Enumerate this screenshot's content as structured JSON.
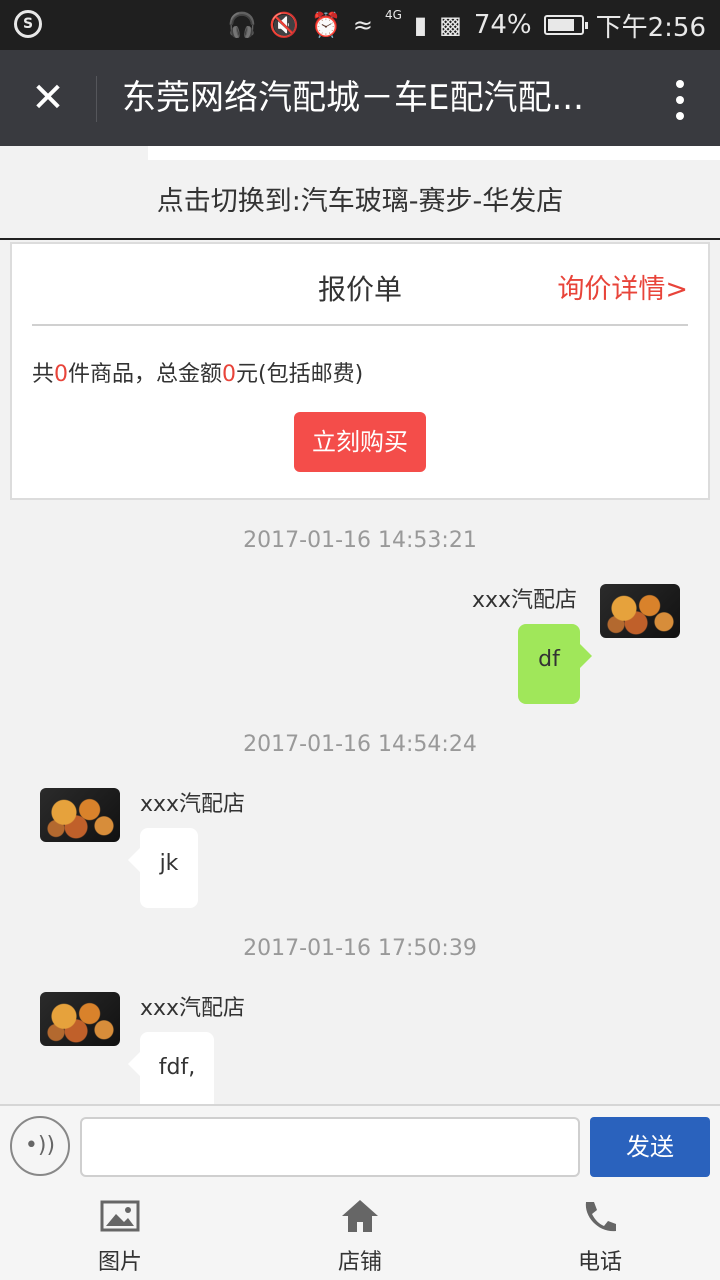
{
  "status_bar": {
    "battery": "74%",
    "time": "下午2:56",
    "network": "4G"
  },
  "title_bar": {
    "title": "东莞网络汽配城－车E配汽配..."
  },
  "switch_store": {
    "text": "点击切换到:汽车玻璃-赛步-华发店"
  },
  "quote_card": {
    "title": "报价单",
    "details_link": "询价详情>",
    "summary_prefix": "共",
    "item_count": "0",
    "summary_middle": "件商品，总金额",
    "total_amount": "0",
    "summary_suffix": "元(包括邮费)",
    "buy_button": "立刻购买"
  },
  "messages": [
    {
      "timestamp": "2017-01-16 14:53:21",
      "sender": "xxx汽配店",
      "text": "df",
      "direction": "outgoing"
    },
    {
      "timestamp": "2017-01-16 14:54:24",
      "sender": "xxx汽配店",
      "text": "jk",
      "direction": "incoming"
    },
    {
      "timestamp": "2017-01-16 17:50:39",
      "sender": "xxx汽配店",
      "text": "fdf,",
      "direction": "incoming"
    }
  ],
  "input_bar": {
    "placeholder": "",
    "send_button": "发送"
  },
  "bottom_nav": [
    {
      "label": "图片",
      "icon": "image-icon"
    },
    {
      "label": "店铺",
      "icon": "home-icon"
    },
    {
      "label": "电话",
      "icon": "phone-icon"
    }
  ],
  "colors": {
    "accent_red": "#e8443a",
    "buy_button": "#f44d4a",
    "send_button": "#2a62bd",
    "outgoing_bubble": "#a0e75a",
    "title_bar": "#393a3f"
  }
}
